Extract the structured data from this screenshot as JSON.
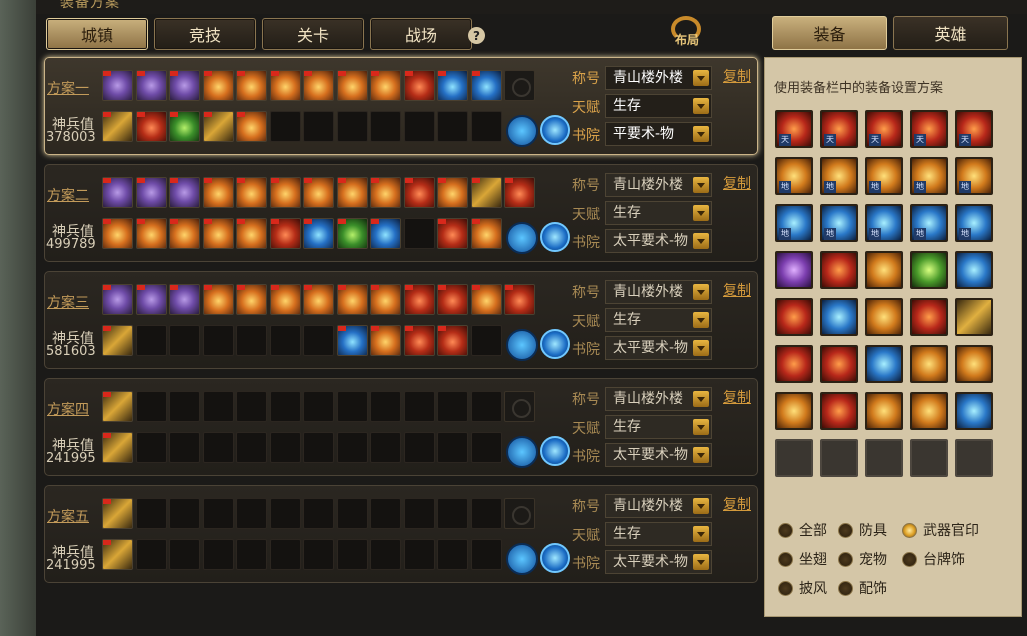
{
  "header": {
    "title_fragment": "装备方案",
    "help_glyph": "?",
    "layout_label": "布局"
  },
  "nav": {
    "tabs": [
      {
        "label": "城镇"
      },
      {
        "label": "竞技"
      },
      {
        "label": "关卡"
      },
      {
        "label": "战场"
      }
    ]
  },
  "right_tabs": [
    {
      "label": "装备"
    },
    {
      "label": "英雄"
    }
  ],
  "plans": [
    {
      "name": "方案一",
      "value_label": "神兵值",
      "value": "378003",
      "title_label": "称号",
      "title_value": "青山楼外楼",
      "talent_label": "天赋",
      "talent_value": "生存",
      "academy_label": "书院",
      "academy_value": "平要术-物",
      "copy": "复制"
    },
    {
      "name": "方案二",
      "value_label": "神兵值",
      "value": "499789",
      "title_label": "称号",
      "title_value": "青山楼外楼",
      "talent_label": "天赋",
      "talent_value": "生存",
      "academy_label": "书院",
      "academy_value": "太平要术-物",
      "copy": "复制"
    },
    {
      "name": "方案三",
      "value_label": "神兵值",
      "value": "581603",
      "title_label": "称号",
      "title_value": "青山楼外楼",
      "talent_label": "天赋",
      "talent_value": "生存",
      "academy_label": "书院",
      "academy_value": "太平要术-物",
      "copy": "复制"
    },
    {
      "name": "方案四",
      "value_label": "神兵值",
      "value": "241995",
      "title_label": "称号",
      "title_value": "青山楼外楼",
      "talent_label": "天赋",
      "talent_value": "生存",
      "academy_label": "书院",
      "academy_value": "太平要术-物",
      "copy": "复制"
    },
    {
      "name": "方案五",
      "value_label": "神兵值",
      "value": "241995",
      "title_label": "称号",
      "title_value": "青山楼外楼",
      "talent_label": "天赋",
      "talent_value": "生存",
      "academy_label": "书院",
      "academy_value": "太平要术-物",
      "copy": "复制"
    }
  ],
  "equip_panel": {
    "instruction": "使用装备栏中的装备设置方案",
    "badges": {
      "tian": "天",
      "di": "地"
    }
  },
  "filters": [
    {
      "label": "全部",
      "checked": false
    },
    {
      "label": "防具",
      "checked": false
    },
    {
      "label": "武器官印",
      "checked": true
    },
    {
      "label": "坐翅",
      "checked": false
    },
    {
      "label": "宠物",
      "checked": false
    },
    {
      "label": "台牌饰",
      "checked": false
    },
    {
      "label": "披风",
      "checked": false
    },
    {
      "label": "配饰",
      "checked": false
    }
  ]
}
